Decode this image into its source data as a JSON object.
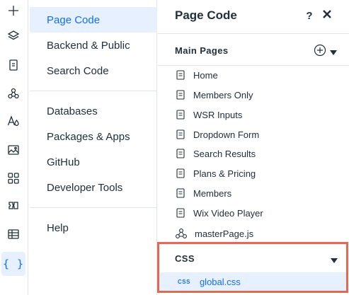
{
  "rail": {
    "icons": [
      "add-icon",
      "layers-icon",
      "pages-icon",
      "design-icon",
      "text-theme-icon",
      "media-icon",
      "apps-icon",
      "business-icon",
      "cms-table-icon",
      "code-braces-icon"
    ],
    "active_brace": "{ }"
  },
  "menu": {
    "items": [
      {
        "label": "Page Code"
      },
      {
        "label": "Backend & Public"
      },
      {
        "label": "Search Code"
      },
      {
        "label": "Databases"
      },
      {
        "label": "Packages & Apps"
      },
      {
        "label": "GitHub"
      },
      {
        "label": "Developer Tools"
      },
      {
        "label": "Help"
      }
    ]
  },
  "panel": {
    "title": "Page Code",
    "help": "?",
    "main_pages": {
      "heading": "Main Pages",
      "pages": [
        {
          "label": "Home"
        },
        {
          "label": "Members Only"
        },
        {
          "label": "WSR Inputs"
        },
        {
          "label": "Dropdown Form"
        },
        {
          "label": "Search Results"
        },
        {
          "label": "Plans & Pricing"
        },
        {
          "label": "Members"
        },
        {
          "label": "Wix Video Player"
        }
      ],
      "master": "masterPage.js"
    },
    "css": {
      "heading": "CSS",
      "file_tag": "CSS",
      "file": "global.css"
    }
  },
  "colors": {
    "accent": "#116dff",
    "selected_bg": "#e7f0ff",
    "highlight_border": "#e26a53",
    "text": "#20303c",
    "divider": "#dfe5eb"
  }
}
